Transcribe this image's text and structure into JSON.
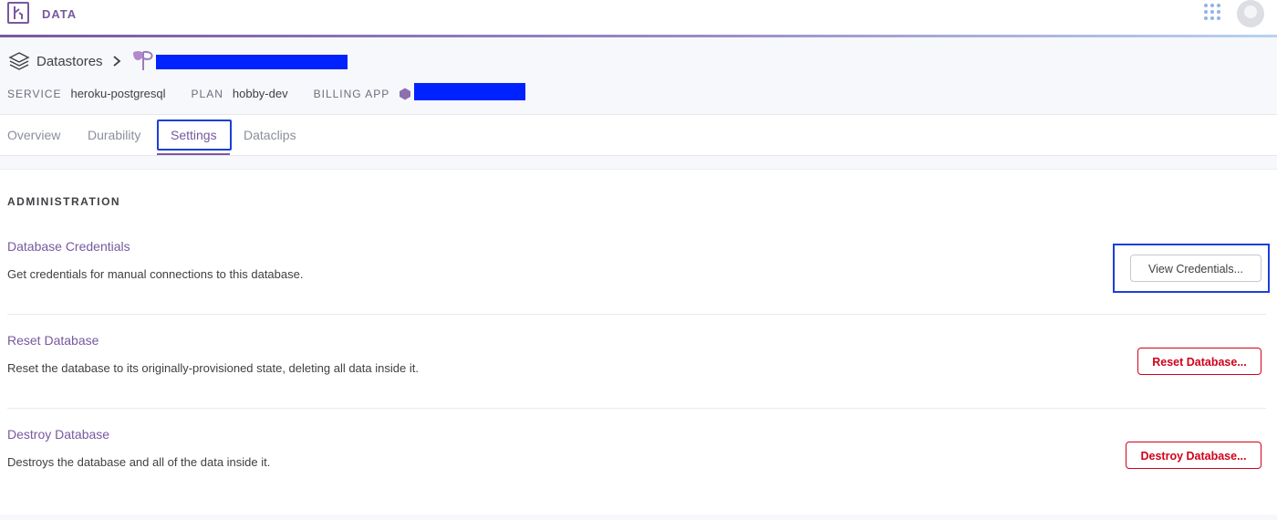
{
  "topbar": {
    "brand": "DATA",
    "icons": [
      "heroku-logo-icon",
      "apps-grid-icon",
      "avatar-icon"
    ]
  },
  "breadcrumb": {
    "root": "Datastores",
    "icons": [
      "datastores-stack-icon",
      "chevron-right-icon",
      "postgres-elephant-icon"
    ]
  },
  "meta": {
    "service_label": "SERVICE",
    "service_value": "heroku-postgresql",
    "plan_label": "PLAN",
    "plan_value": "hobby-dev",
    "billing_label": "BILLING APP"
  },
  "tabs": [
    {
      "label": "Overview",
      "active": false
    },
    {
      "label": "Durability",
      "active": false
    },
    {
      "label": "Settings",
      "active": true
    },
    {
      "label": "Dataclips",
      "active": false
    }
  ],
  "administration": {
    "heading": "ADMINISTRATION",
    "items": [
      {
        "title": "Database Credentials",
        "description": "Get credentials for manual connections to this database.",
        "button": "View Credentials..."
      },
      {
        "title": "Reset Database",
        "description": "Reset the database to its originally-provisioned state, deleting all data inside it.",
        "button": "Reset Database..."
      },
      {
        "title": "Destroy Database",
        "description": "Destroys the database and all of the data inside it.",
        "button": "Destroy Database..."
      }
    ]
  },
  "colors": {
    "brand_purple": "#79589f",
    "danger_red": "#d0021b",
    "highlight_blue": "#1a3fd9",
    "redaction_blue": "#0022ff"
  }
}
